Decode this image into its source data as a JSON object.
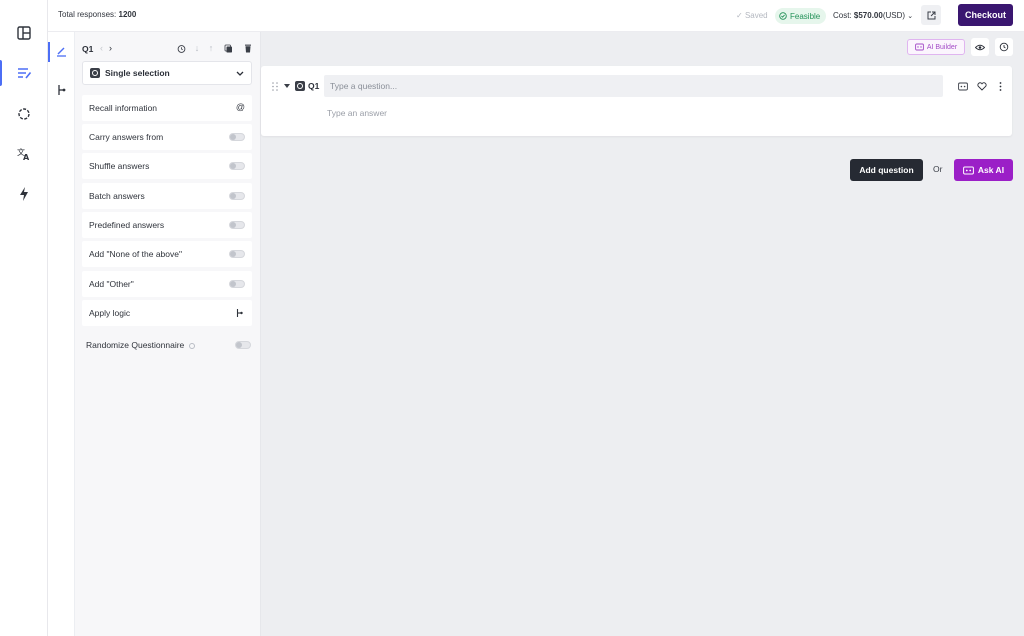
{
  "header": {
    "total_label": "Total responses:",
    "total_value": "1200",
    "saved": "Saved",
    "feasible": "Feasible",
    "cost_label": "Cost:",
    "cost_value": "$570.00",
    "cost_currency": "(USD)",
    "checkout": "Checkout"
  },
  "panel": {
    "question_id": "Q1",
    "question_type": "Single selection",
    "options": [
      {
        "label": "Recall information"
      },
      {
        "label": "Carry answers from"
      },
      {
        "label": "Shuffle answers"
      },
      {
        "label": "Batch answers"
      },
      {
        "label": "Predefined answers"
      },
      {
        "label": "Add \"None of the above\""
      },
      {
        "label": "Add \"Other\""
      },
      {
        "label": "Apply logic"
      }
    ],
    "randomize": "Randomize Questionnaire"
  },
  "canvas": {
    "ai_builder": "AI Builder",
    "question_id": "Q1",
    "question_placeholder": "Type a question...",
    "answer_placeholder": "Type an answer",
    "add_question": "Add question",
    "or": "Or",
    "ask_ai": "Ask AI"
  },
  "colors": {
    "checkout_bg": "#3a1670",
    "ask_ai_bg": "#9b1fc7",
    "accent_blue": "#4c6ef5",
    "feasible_green": "#239158"
  }
}
